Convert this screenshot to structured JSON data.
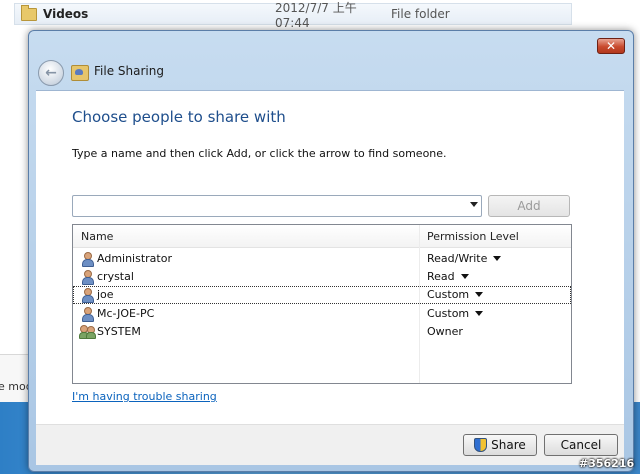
{
  "background": {
    "row": {
      "name": "Videos",
      "date": "2012/7/7 上午 07:44",
      "type": "File folder"
    },
    "left_text": "e mod"
  },
  "dialog": {
    "close_label": "✕",
    "title": "File Sharing",
    "heading": "Choose people to share with",
    "instruction": "Type a name and then click Add, or click the arrow to find someone.",
    "name_input": {
      "value": "",
      "placeholder": ""
    },
    "add_label": "Add",
    "list": {
      "columns": {
        "name": "Name",
        "permission": "Permission Level"
      },
      "rows": [
        {
          "name": "Administrator",
          "permission": "Read/Write",
          "icon": "user-icon"
        },
        {
          "name": "crystal",
          "permission": "Read",
          "icon": "user-icon"
        },
        {
          "name": "joe",
          "permission": "Custom",
          "icon": "user-icon"
        },
        {
          "name": "Mc-JOE-PC",
          "permission": "Custom",
          "icon": "user-icon"
        },
        {
          "name": "SYSTEM",
          "permission": "Owner",
          "icon": "group-icon"
        }
      ]
    },
    "trouble_link": "I'm having trouble sharing",
    "share_label": "Share",
    "cancel_label": "Cancel"
  },
  "watermark": "#356216",
  "colors": {
    "heading": "#1e4e8c",
    "link": "#0b63bd",
    "close": "#c94a2e"
  }
}
